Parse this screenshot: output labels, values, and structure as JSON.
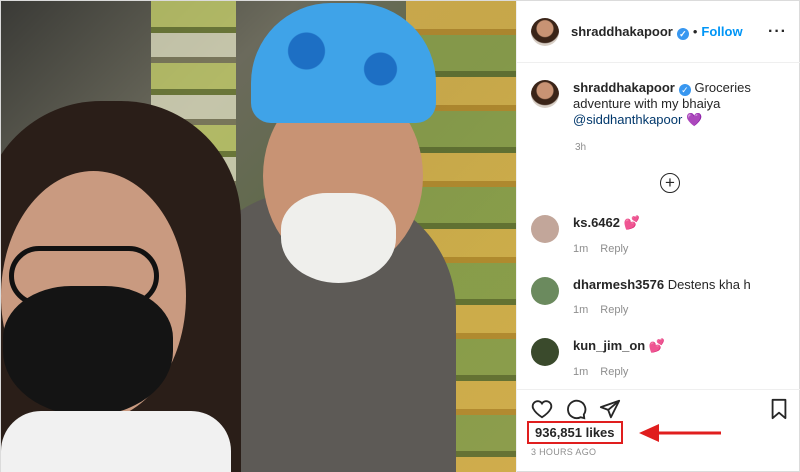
{
  "post": {
    "username": "shraddhakapoor",
    "follow_label": "Follow",
    "more_icon": "more-options-icon",
    "caption": {
      "username": "shraddhakapoor",
      "text": "Groceries adventure with my bhaiya",
      "mention": "@siddhanthkapoor",
      "emoji": "💜",
      "time": "3h"
    },
    "comments": [
      {
        "username": "ks.6462",
        "text": "💕",
        "time": "1m",
        "reply": "Reply",
        "avatar_color": "#c2a69a"
      },
      {
        "username": "dharmesh3576",
        "text": "Destens kha h",
        "time": "1m",
        "reply": "Reply",
        "avatar_color": "#6b8a5e"
      },
      {
        "username": "kun_jim_on",
        "text": "💕",
        "time": "1m",
        "reply": "Reply",
        "avatar_color": "#3a4a2c"
      }
    ],
    "likes": "936,851 likes",
    "posted_time": "3 HOURS AGO",
    "colors": {
      "follow": "#0095f6",
      "highlight_box": "#e01e1e",
      "arrow": "#e01e1e"
    }
  }
}
